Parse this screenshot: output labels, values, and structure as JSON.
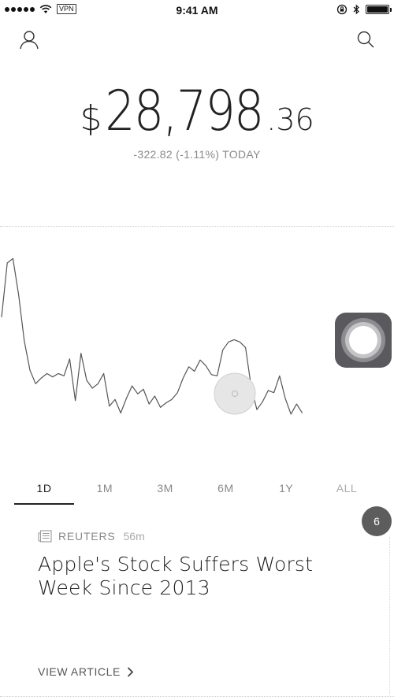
{
  "status_bar": {
    "time": "9:41 AM",
    "vpn": "VPN",
    "signal_icon": "signal-dots-icon",
    "wifi_icon": "wifi-icon",
    "lock_icon": "orientation-lock-icon",
    "bluetooth_icon": "bluetooth-icon",
    "battery_icon": "battery-icon"
  },
  "header": {
    "profile_icon": "person-icon",
    "search_icon": "search-icon"
  },
  "portfolio": {
    "currency": "$",
    "whole": "28,798",
    "cents": ".36",
    "change": "-322.82 (-1.11%) TODAY"
  },
  "chart_data": {
    "type": "line",
    "y": [
      200,
      296,
      304,
      240,
      158,
      106,
      82,
      92,
      100,
      94,
      100,
      96,
      126,
      52,
      136,
      88,
      74,
      82,
      100,
      42,
      54,
      30,
      56,
      78,
      64,
      72,
      46,
      60,
      40,
      48,
      54,
      66,
      92,
      112,
      104,
      124,
      114,
      98,
      96,
      142,
      156,
      160,
      156,
      146,
      76,
      36,
      50,
      70,
      66,
      96,
      56,
      28,
      46,
      30
    ]
  },
  "assistive_touch": {
    "icon": "assistive-touch-icon"
  },
  "timeframes": [
    "1D",
    "1M",
    "3M",
    "6M",
    "1Y",
    "ALL"
  ],
  "active_timeframe": "1D",
  "news": {
    "badge_count": "6",
    "icon": "newspaper-icon",
    "source": "REUTERS",
    "time": "56m",
    "headline_line1": "Apple's Stock Suffers Worst",
    "headline_line2": "Week Since 2013",
    "cta": "VIEW ARTICLE",
    "cta_icon": "chevron-right-icon"
  },
  "colors": {
    "line": "#555555",
    "accent_touch": "#5a5a5e"
  }
}
